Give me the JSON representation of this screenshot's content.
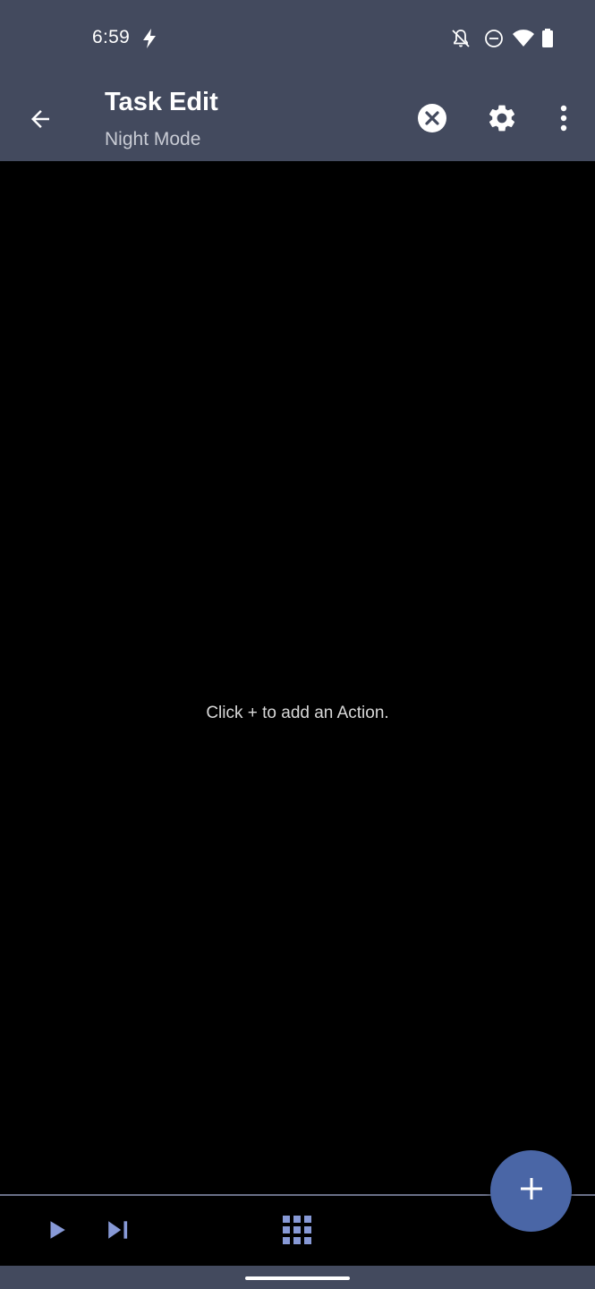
{
  "status_bar": {
    "time": "6:59",
    "icons": [
      "flash-icon",
      "notifications-off-icon",
      "do-not-disturb-icon",
      "wifi-icon",
      "battery-icon"
    ]
  },
  "app_bar": {
    "title": "Task Edit",
    "subtitle": "Night Mode",
    "icons": [
      "back-arrow-icon",
      "cancel-icon",
      "settings-icon",
      "more-vert-icon"
    ]
  },
  "main": {
    "empty_hint": "Click + to add an Action."
  },
  "bottom_bar": {
    "icons": [
      "play-icon",
      "skip-next-icon",
      "grid-icon",
      "add-icon"
    ]
  },
  "colors": {
    "bar_background": "#434a5e",
    "content_background": "#000000",
    "accent": "#4a66a6",
    "bottom_icon": "#8799d6"
  }
}
